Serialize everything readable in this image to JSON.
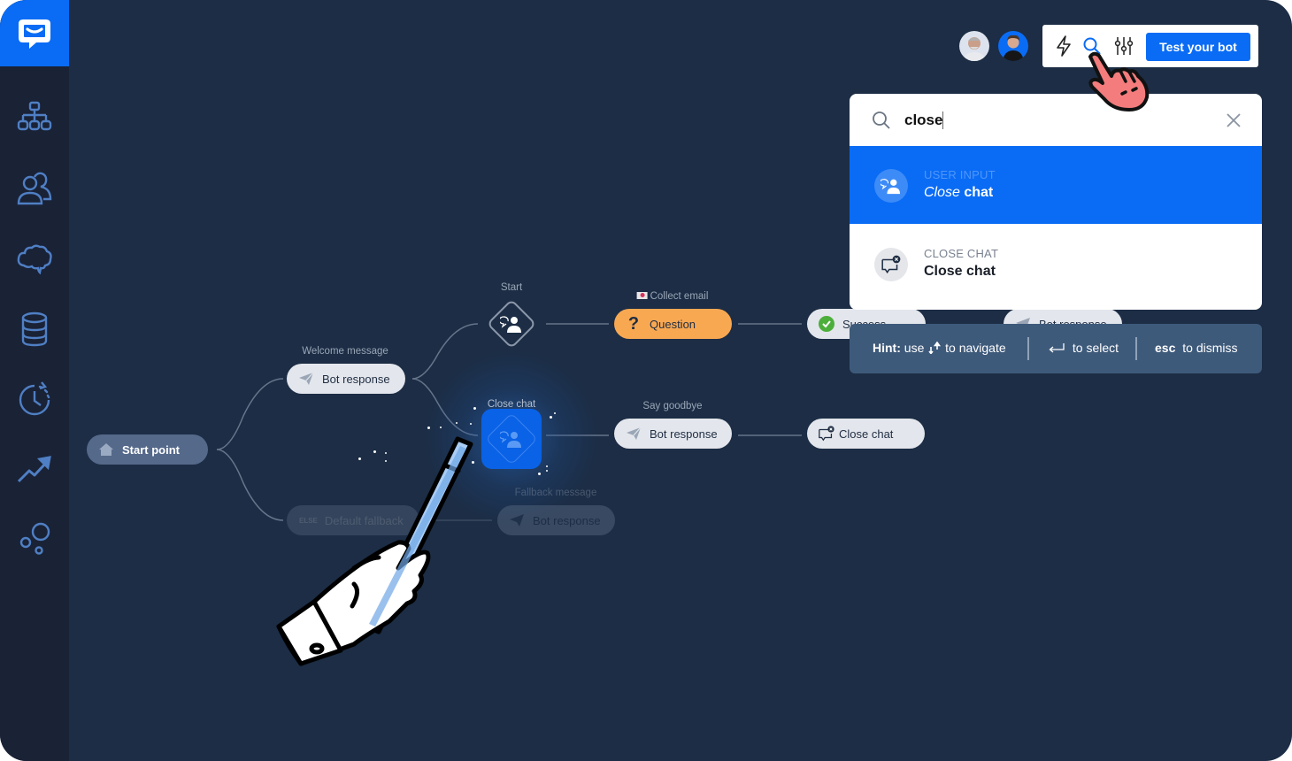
{
  "app": {
    "brand_color": "#0a6cf5",
    "logo_icon": "chat-bubble-logo-icon"
  },
  "sidebar": {
    "items": [
      {
        "name": "flows",
        "icon": "sitemap-icon"
      },
      {
        "name": "users",
        "icon": "users-icon"
      },
      {
        "name": "training",
        "icon": "brain-icon"
      },
      {
        "name": "data",
        "icon": "database-icon"
      },
      {
        "name": "history",
        "icon": "clock-history-icon"
      },
      {
        "name": "reports",
        "icon": "trending-up-icon"
      },
      {
        "name": "integrations",
        "icon": "bubbles-icon"
      }
    ]
  },
  "header": {
    "avatars": [
      {
        "name": "collaborator-1",
        "bg": "#dde3ee"
      },
      {
        "name": "collaborator-2",
        "bg": "#0a6cf5"
      }
    ],
    "tools": {
      "lightning": "lightning-icon",
      "search": "search-icon",
      "settings": "sliders-icon"
    },
    "test_button_label": "Test your bot"
  },
  "search": {
    "query": "close",
    "results": [
      {
        "type": "USER INPUT",
        "title_highlight": "Close",
        "title_rest": " chat",
        "icon": "user-input-icon",
        "active": true
      },
      {
        "type": "CLOSE CHAT",
        "title": "Close chat",
        "icon": "close-chat-icon",
        "active": false
      }
    ],
    "hint": {
      "label": "Hint:",
      "navigate_pre": "use",
      "navigate_post": "to navigate",
      "select": "to select",
      "esc_key": "esc",
      "dismiss": "to dismiss"
    }
  },
  "flow": {
    "start_point": "Start point",
    "welcome_label": "Welcome message",
    "welcome_node": "Bot response",
    "fallback_node_tag": "ELSE",
    "fallback_node": "Default fallback",
    "start_label": "Start",
    "collect_email_label": "Collect email",
    "question_node": "Question",
    "success_node": "Success",
    "upper_bot_response": "Bot response",
    "close_chat_label": "Close chat",
    "say_goodbye_label": "Say goodbye",
    "goodbye_node": "Bot response",
    "close_chat_node": "Close chat",
    "fallback_message_label": "Fallback message",
    "fallback_message_node": "Bot response"
  }
}
